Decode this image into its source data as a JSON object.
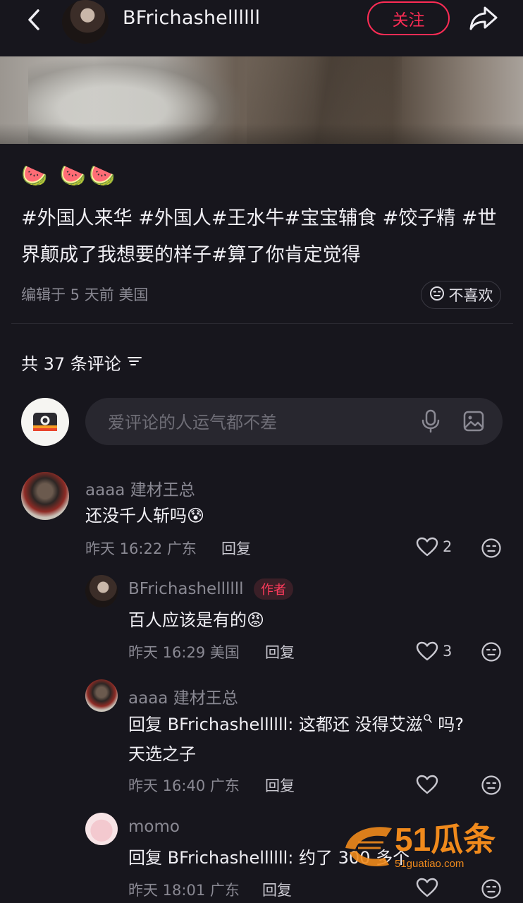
{
  "header": {
    "username": "BFrichashellllll",
    "follow_label": "关注"
  },
  "post": {
    "emojis": "🍉 🍉🍉",
    "caption": "#外国人来华 #外国人#王水牛#宝宝辅食 #饺子精 #世界颠成了我想要的样子#算了你肯定觉得",
    "meta": "编辑于 5 天前 美国",
    "dislike_label": "不喜欢"
  },
  "comments_header": {
    "count_text": "共 37 条评论"
  },
  "comment_input": {
    "placeholder": "爱评论的人运气都不差"
  },
  "comments": [
    {
      "name": "aaaa 建材王总",
      "text": "还没千人斩吗",
      "emoji": "😰",
      "time": "昨天 16:22 广东",
      "reply_label": "回复",
      "likes": "2"
    },
    {
      "name": "BFrichashellllll",
      "author_tag": "作者",
      "text": "百人应该是有的",
      "emoji": "😡",
      "time": "昨天 16:29 美国",
      "reply_label": "回复",
      "likes": "3"
    },
    {
      "name": "aaaa 建材王总",
      "text_line1": "回复 BFrichashellllll: 这都还 没得艾滋",
      "text_line1_suffix": " 吗?",
      "text_line2": "天选之子",
      "time": "昨天 16:40 广东",
      "reply_label": "回复"
    },
    {
      "name": "momo",
      "text": "回复 BFrichashellllll: 约了 300 多个",
      "time": "昨天 18:01 广东",
      "reply_label": "回复"
    }
  ],
  "watermark": {
    "brand": "51瓜条",
    "url": "51guatiao.com"
  },
  "colors": {
    "background": "#17161d",
    "accent": "#ff2c55",
    "muted_text": "#8a8993"
  }
}
